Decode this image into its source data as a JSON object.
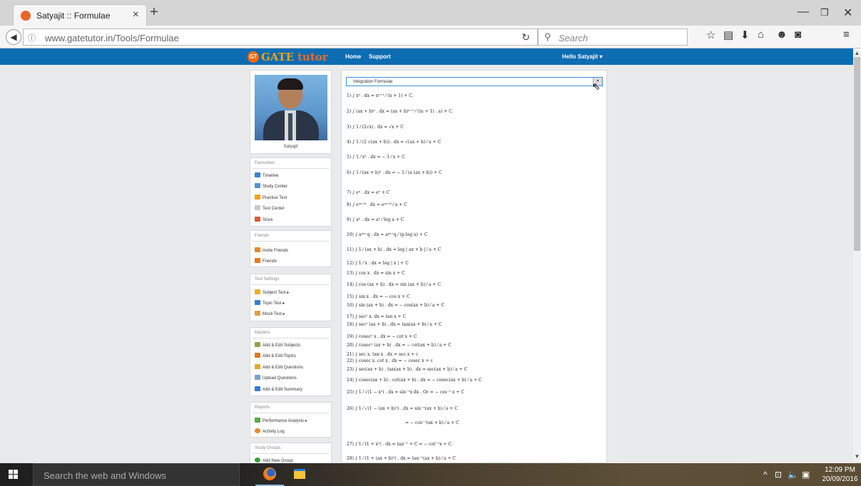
{
  "browser": {
    "tab_title": "Satyajit :: Formulae",
    "url": "www.gatetutor.in/Tools/Formulae",
    "search_placeholder": "Search"
  },
  "site": {
    "logo_left": "GATE",
    "logo_right": "tutor",
    "logo_badge": "GT",
    "nav": [
      "Home",
      "Support"
    ],
    "user_menu": "Hello Satyajit ▾"
  },
  "profile": {
    "name": "Satyajit"
  },
  "sidebar": [
    {
      "title": "Favourites",
      "items": [
        "Timeline",
        "Study Center",
        "Practice Test",
        "Test Center",
        "Store"
      ]
    },
    {
      "title": "Friends",
      "items": [
        "Invite Friends",
        "Friends"
      ]
    },
    {
      "title": "Test Settings",
      "items": [
        "Subject Test ▸",
        "Topic Test ▸",
        "Mock Test ▸"
      ]
    },
    {
      "title": "Masters",
      "items": [
        "Add & Edit Subjects",
        "Add & Edit Topics",
        "Add & Edit Questions",
        "Upload Questions",
        "Add & Edit Summary"
      ]
    },
    {
      "title": "Reports",
      "items": [
        "Performance Analysis ▸",
        "Activity Log"
      ]
    },
    {
      "title": "Study Groups",
      "items": [
        "Add New Group"
      ]
    }
  ],
  "selector": {
    "value": "Integration Formulae"
  },
  "formulae": [
    "1)  ∫ xⁿ . dx  =  xⁿ⁺¹ ⁄ (n + 1) + C.",
    "2)  ∫ (ax + b)ⁿ . dx  =  (ax + b)ⁿ⁺¹ ⁄ ((n + 1) . a) + C.",
    "3)  ∫ 1 ⁄ (2√x) . dx  =  √x + C",
    "4)  ∫ 1 ⁄ (2 √(ax + b)) . dx  =  √(ax + b) ⁄ a + C",
    "5)  ∫ 1 ⁄ x² . dx  =  − 1 ⁄ x + C",
    "6)  ∫ 1 ⁄ (ax + b)² . dx  =  − 1 ⁄ (a (ax + b)) + C",
    "7)  ∫ eˣ . dx  =  eˣ + C",
    "8)  ∫ eᵃˣ⁺ᵇ . dx  =  eᵃˣ⁺ᵇ ⁄ a + C",
    "9)  ∫ aˣ . dx  =  aˣ ⁄ log a + C",
    "10)  ∫ aᵖˣ⁺q . dx  =  aᵖˣ⁺q ⁄ (p.log a) + C",
    "11)  ∫ 1 ⁄ (ax + b) . dx  =  log | ax + b | ⁄ a + C",
    "12)  ∫ 1 ⁄ x . dx  =  log | x | + C",
    "13)  ∫ cos x . dx  =  sin x + C",
    "14)  ∫ cos (ax + b) . dx  =  sin (ax + b) ⁄ a + C",
    "15)  ∫ sin x . dx  =  − cos x + C",
    "16)  ∫ sin (ax + b) . dx  =  − cos(ax + b) ⁄ a + C",
    "17)  ∫ sec² x. dx  =  tan x + C",
    "18)  ∫ sec² (ax + b) . dx  =  tan(ax + b) ⁄ a + C",
    "19)  ∫ cosec² x . dx  =  − cot x + C",
    "20)  ∫ cosec² (ax + b) . dx  =  − cot(ax + b) ⁄ a + C",
    "21)  ∫ sec x. tan x . dx  =  sec x + c",
    "22)  ∫ cosec x. cot x . dx  =  − cosec x + c",
    "23)  ∫ sec(ax + b) . tan(ax + b) . dx  =  sec(ax + b) ⁄ a + C",
    "24)  ∫ cosec(ax + b) . cot(ax + b) . dx  =  − cosec(ax + b) ⁄ a + C",
    "25)  ∫ 1 ⁄ √(1 − x²) . dx  =  sin⁻¹x dx .  Or  =  − cos⁻¹ x + C",
    "26)  ∫ 1 ⁄ √(1 − (ax + b)²) . dx  =  sin⁻¹(ax + b) ⁄ a + C",
    "=  − cos⁻¹(ax + b) ⁄ a + C",
    "27)  ∫ 1 ⁄ (1 + x²) . dx  =  tan⁻¹ + C  =  − cot⁻¹x + C.",
    "28)  ∫ 1 ⁄ (1 + (ax + b)²) . dx  =  tan⁻¹(ax + b) ⁄ a + C"
  ],
  "taskbar": {
    "search_placeholder": "Search the web and Windows",
    "time": "12:09 PM",
    "date": "20/09/2016"
  }
}
